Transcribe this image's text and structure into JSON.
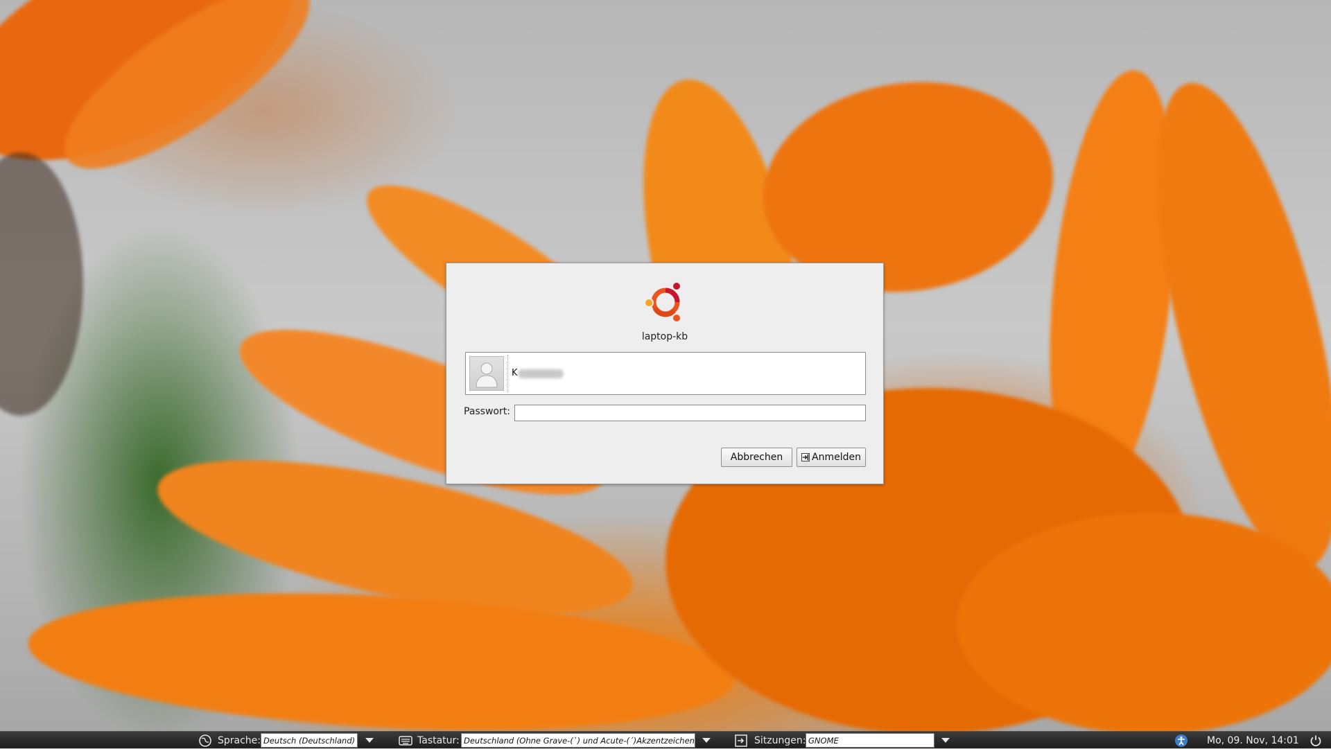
{
  "dialog": {
    "hostname": "laptop-kb",
    "user": {
      "name_visible": "K"
    },
    "password": {
      "label": "Passwort:",
      "value": ""
    },
    "buttons": {
      "cancel": "Abbrechen",
      "login": "Anmelden"
    }
  },
  "panel": {
    "language": {
      "label": "Sprache:",
      "value": "Deutsch (Deutschland)"
    },
    "keyboard": {
      "label": "Tastatur:",
      "value": "Deutschland (Ohne Grave-(`) und Acute-(´)Akzentzeichen)"
    },
    "session": {
      "label": "Sitzungen:",
      "value": "GNOME"
    },
    "clock": "Mo, 09. Nov, 14:01"
  },
  "colors": {
    "panel_bg": "#2a2a2a",
    "dialog_bg": "#eeeeee",
    "ubuntu_orange": "#e95420",
    "ubuntu_red": "#c7162b",
    "ubuntu_yellow": "#f5a623"
  },
  "icons": [
    "ubuntu-logo-icon",
    "user-avatar-icon",
    "login-icon",
    "language-globe-icon",
    "keyboard-icon",
    "session-icon",
    "accessibility-icon",
    "power-icon",
    "dropdown-arrow-icon"
  ]
}
